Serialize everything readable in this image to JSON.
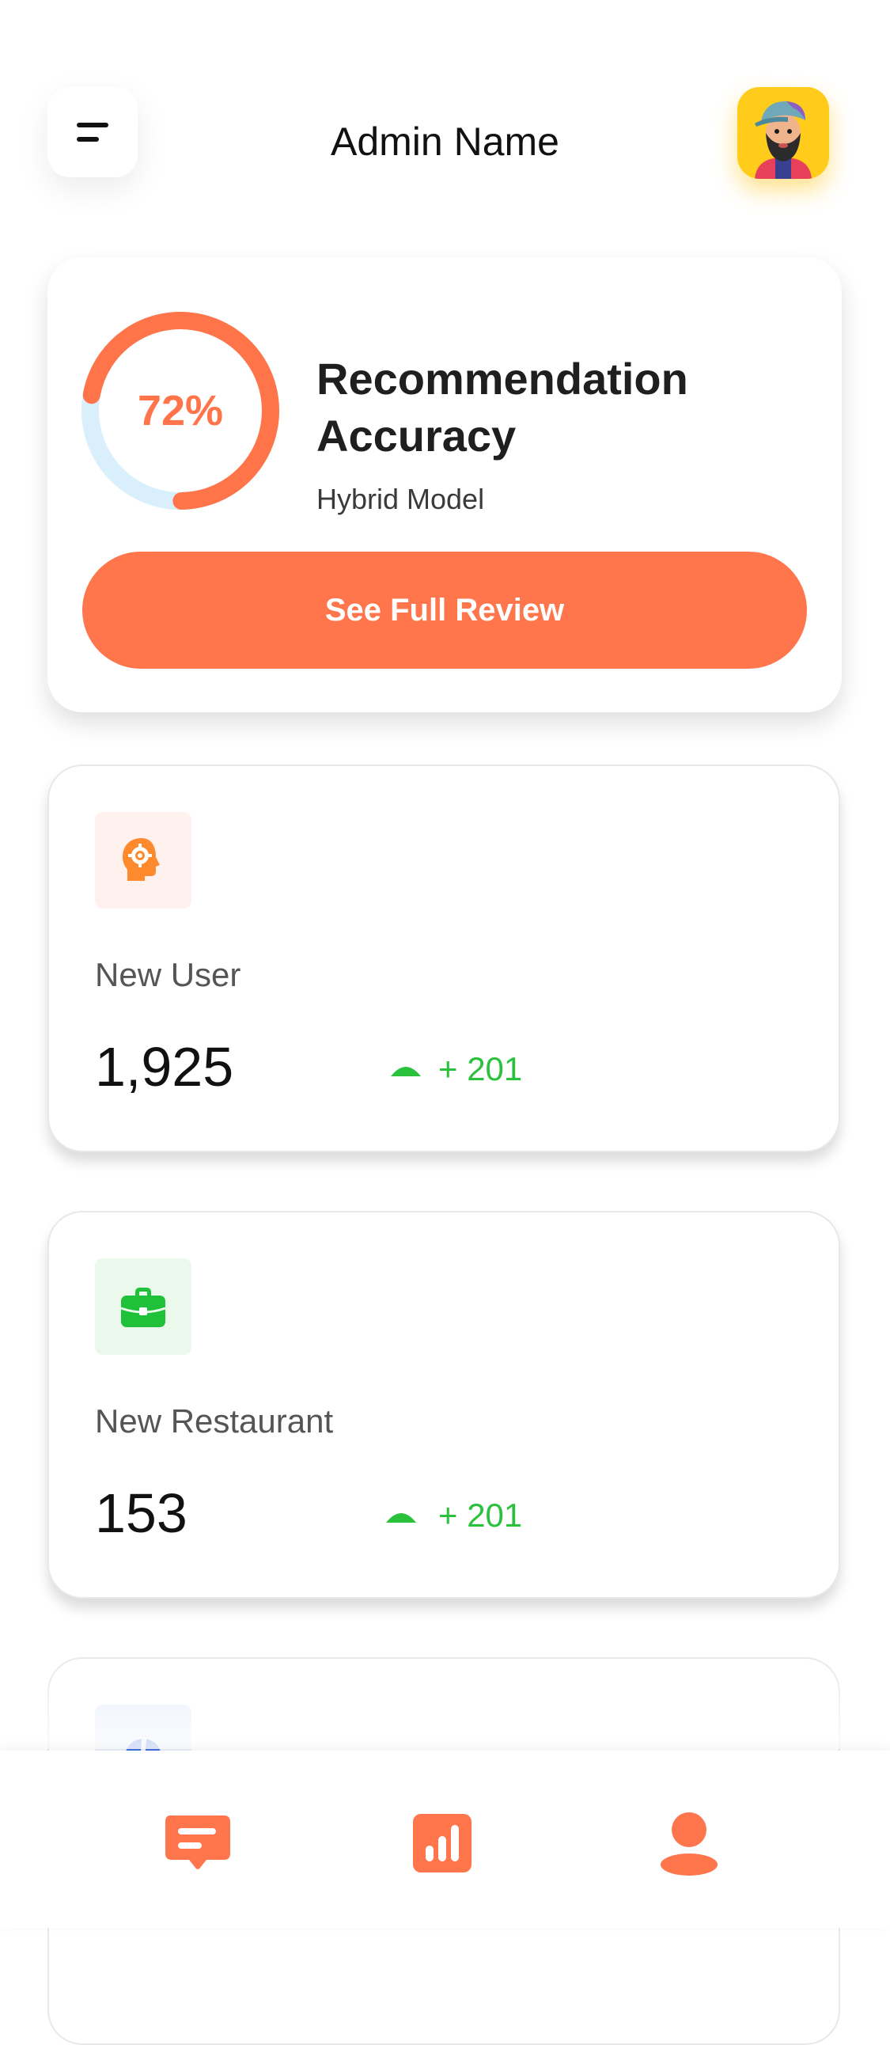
{
  "header": {
    "title": "Admin Name",
    "menu_icon": "menu-icon",
    "avatar_icon": "avatar"
  },
  "accuracy_card": {
    "percent_label": "72%",
    "percent_value": 72,
    "title_line1": "Recommendation",
    "title_line2": "Accuracy",
    "subtitle": "Hybrid Model",
    "button_label": "See Full Review",
    "ring_color": "#ff7549",
    "ring_track_color": "#d9effb"
  },
  "stats": [
    {
      "label": "New User",
      "value": "1,925",
      "change": "+ 201",
      "icon": "head-gear-icon",
      "icon_color": "#ff8a2e",
      "icon_bg": "#fff1ee"
    },
    {
      "label": "New Restaurant",
      "value": "153",
      "change": "+ 201",
      "icon": "briefcase-icon",
      "icon_color": "#1fc13a",
      "icon_bg": "#eaf9ec"
    },
    {
      "label": "",
      "value": "",
      "change": "",
      "icon": "helmet-icon",
      "icon_color": "#3f6fe0",
      "icon_bg": "#e8eefb"
    }
  ],
  "trend_color": "#2bc13c",
  "bottom_nav": {
    "items": [
      "chat-icon",
      "chart-icon",
      "profile-icon"
    ],
    "accent": "#ff754c"
  }
}
